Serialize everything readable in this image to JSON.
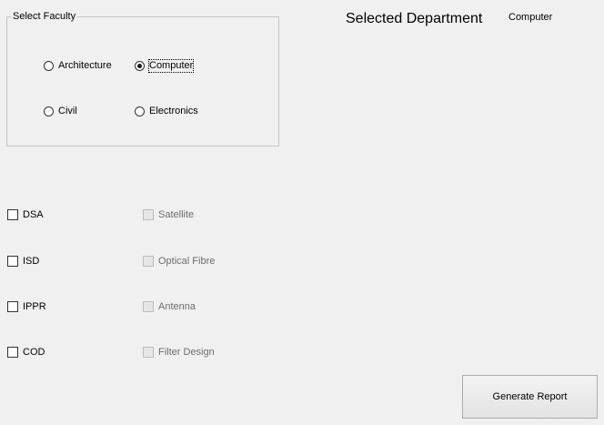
{
  "faculty_group": {
    "title": "Select Faculty",
    "options": [
      {
        "label": "Architecture",
        "checked": false
      },
      {
        "label": "Computer",
        "checked": true
      },
      {
        "label": "Civil",
        "checked": false
      },
      {
        "label": "Electronics",
        "checked": false
      }
    ]
  },
  "department": {
    "title": "Selected Department",
    "value": "Computer"
  },
  "computer_subjects": [
    {
      "label": "DSA",
      "checked": false,
      "enabled": true
    },
    {
      "label": "ISD",
      "checked": false,
      "enabled": true
    },
    {
      "label": "IPPR",
      "checked": false,
      "enabled": true
    },
    {
      "label": "COD",
      "checked": false,
      "enabled": true
    }
  ],
  "electronics_subjects": [
    {
      "label": "Satellite",
      "checked": false,
      "enabled": false
    },
    {
      "label": "Optical Fibre",
      "checked": false,
      "enabled": false
    },
    {
      "label": "Antenna",
      "checked": false,
      "enabled": false
    },
    {
      "label": "Filter Design",
      "checked": false,
      "enabled": false
    }
  ],
  "actions": {
    "generate_report_label": "Generate Report"
  }
}
